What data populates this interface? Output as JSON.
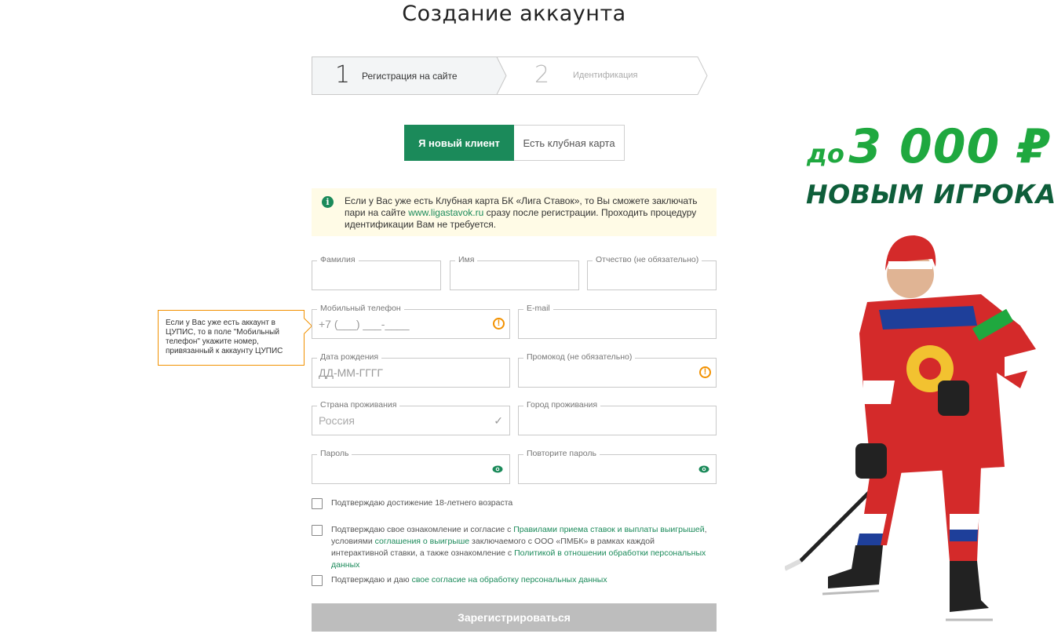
{
  "page": {
    "title": "Создание аккаунта"
  },
  "steps": [
    {
      "number": "1",
      "label": "Регистрация на сайте"
    },
    {
      "number": "2",
      "label": "Идентификация"
    }
  ],
  "tabs": {
    "new_client": "Я новый клиент",
    "club_card": "Есть клубная карта"
  },
  "info": {
    "text_before": "Если у Вас уже есть Клубная карта БК «Лига Ставок», то Вы сможете заключать пари на сайте ",
    "link": "www.ligastavok.ru",
    "text_after": " сразу после регистрации. Проходить процедуру идентификации Вам не требуется."
  },
  "form": {
    "last_name_label": "Фамилия",
    "first_name_label": "Имя",
    "middle_name_label": "Отчество  (не обязательно)",
    "phone_label": "Мобильный телефон",
    "phone_placeholder": "+7 (___) ___-____",
    "email_label": "E-mail",
    "birth_label": "Дата рождения",
    "birth_placeholder": "ДД-ММ-ГГГГ",
    "promo_label": "Промокод  (не обязательно)",
    "country_label": "Страна проживания",
    "country_value": "Россия",
    "city_label": "Город проживания",
    "password_label": "Пароль",
    "password_repeat_label": "Повторите пароль"
  },
  "tooltip": {
    "text": "Если у Вас уже есть аккаунт в ЦУПИС, то в поле \"Мобильный телефон\" укажите номер, привязанный к аккаунту ЦУПИС"
  },
  "consents": {
    "age": "Подтверждаю достижение 18-летнего возраста",
    "rules_1": "Подтверждаю свое ознакомление и согласие с ",
    "rules_link1": "Правилами приема ставок и выплаты выигрышей",
    "rules_2": ", условиями ",
    "rules_link2": "соглашения о выигрыше",
    "rules_3": " заключаемого с ООО «ПМБК» в рамках каждой интерактивной ставки, а также ознакомление с ",
    "rules_link3": "Политикой в отношении обработки персональных данных",
    "personal_1": "Подтверждаю и даю ",
    "personal_link": "свое согласие на обработку персональных данных"
  },
  "submit_label": "Зарегистрироваться",
  "promo": {
    "prefix": "до",
    "amount": "3 000 ₽",
    "subtitle": "НОВЫМ ИГРОКАМ"
  },
  "colors": {
    "brand_green": "#1b8a5a",
    "promo_green": "#1fa83f",
    "warning_orange": "#f29100",
    "disabled_gray": "#bdbdbd"
  }
}
